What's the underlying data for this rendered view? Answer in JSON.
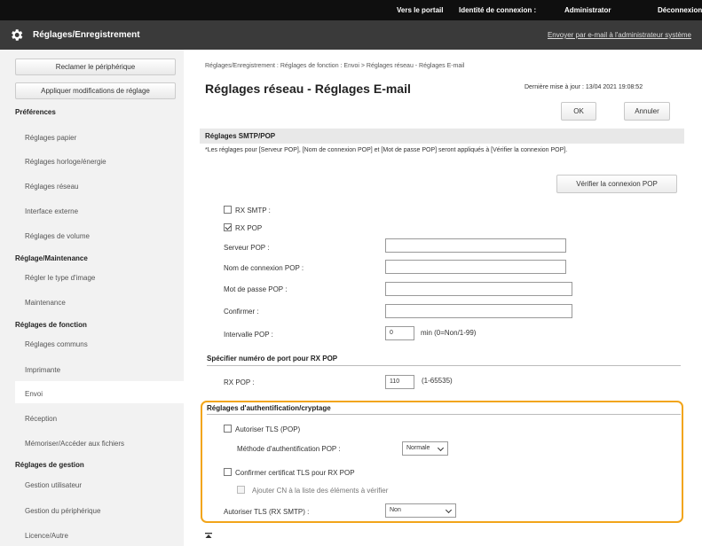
{
  "topbar": {
    "portal": "Vers le portail",
    "login_label": "Identité de connexion :",
    "user": "Administrator",
    "logout": "Déconnexion"
  },
  "titlebar": {
    "title": "Réglages/Enregistrement",
    "mail_admin": "Envoyer par e-mail à l'administrateur système",
    "icon": "gear-icon"
  },
  "sidebar": {
    "reclaim_button": "Reclamer le périphérique",
    "apply_button": "Appliquer modifications de réglage",
    "sections": [
      {
        "title": "Préférences",
        "items": [
          "Réglages papier",
          "Réglages horloge/énergie",
          "Réglages réseau",
          "Interface externe",
          "Réglages de volume"
        ]
      },
      {
        "title": "Réglage/Maintenance",
        "items": [
          "Régler le type d'image",
          "Maintenance"
        ]
      },
      {
        "title": "Réglages de fonction",
        "items": [
          "Réglages communs",
          "Imprimante",
          "Envoi",
          "Réception",
          "Mémoriser/Accéder aux fichiers"
        ]
      },
      {
        "title": "Réglages de gestion",
        "items": [
          "Gestion utilisateur",
          "Gestion du périphérique",
          "Licence/Autre"
        ]
      }
    ],
    "selected": "Envoi"
  },
  "main": {
    "breadcrumb": "Réglages/Enregistrement : Réglages de fonction : Envoi > Réglages réseau - Réglages E-mail",
    "title": "Réglages réseau - Réglages E-mail",
    "updated": "Dernière mise à jour : 13/04 2021 19:08:52",
    "ok": "OK",
    "cancel": "Annuler",
    "smtp_section": "Réglages SMTP/POP",
    "note": "*Les réglages pour [Serveur POP], [Nom de connexion POP] et [Mot de passe POP] seront appliqués à [Vérifier la connexion POP].",
    "verify_pop": "Vérifier la connexion POP",
    "rx_smtp": "RX SMTP :",
    "rx_pop": "RX POP",
    "pop_server_label": "Serveur POP :",
    "pop_login_label": "Nom de connexion POP :",
    "pop_password_label": "Mot de passe POP :",
    "confirm_label": "Confirmer :",
    "pop_interval_label": "Intervalle POP :",
    "pop_interval_value": "0",
    "pop_interval_hint": "min (0=Non/1-99)",
    "port_section": "Spécifier numéro de port pour RX POP",
    "rx_pop_port_label": "RX POP :",
    "rx_pop_port_value": "110",
    "rx_pop_port_hint": "(1-65535)",
    "auth_section": "Réglages d'authentification/cryptage",
    "allow_tls_pop": "Autoriser TLS (POP)",
    "pop_auth_method_label": "Méthode d'authentification POP :",
    "pop_auth_method_value": "Normale",
    "confirm_tls_cert": "Confirmer certificat TLS pour RX POP",
    "add_cn": "Ajouter CN à la liste des éléments à vérifier",
    "allow_tls_smtp_label": "Autoriser TLS (RX SMTP) :",
    "allow_tls_smtp_value": "Non"
  },
  "colors": {
    "topbar": "#0f0f0f",
    "titlebar": "#3a3a3a",
    "highlight": "#f2a51a"
  }
}
